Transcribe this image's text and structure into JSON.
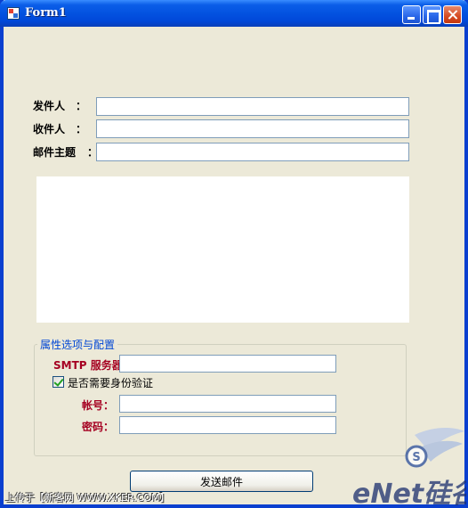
{
  "window": {
    "title": "Form1"
  },
  "form": {
    "sender_label": "发件人",
    "recipient_label": "收件人",
    "subject_label": "邮件主题",
    "colon": "：",
    "sender_value": "",
    "recipient_value": "",
    "subject_value": "",
    "body_value": ""
  },
  "settings": {
    "group_title": "属性选项与配置",
    "smtp_label": "SMTP 服务器:",
    "smtp_value": "",
    "auth_label": "是否需要身份验证",
    "auth_checked": true,
    "account_label": "帐号：",
    "account_value": "",
    "password_label": "密码：",
    "password_value": ""
  },
  "actions": {
    "send_label": "发送邮件"
  },
  "footer": {
    "upload_note": "上传于【新客网 WWW.XKER.COM】",
    "watermark_text": "eNet硅谷动力"
  },
  "colors": {
    "window_bg": "#ece9d8",
    "titlebar": "#0352e0",
    "group_title": "#0046d5",
    "settings_label": "#a50021"
  }
}
